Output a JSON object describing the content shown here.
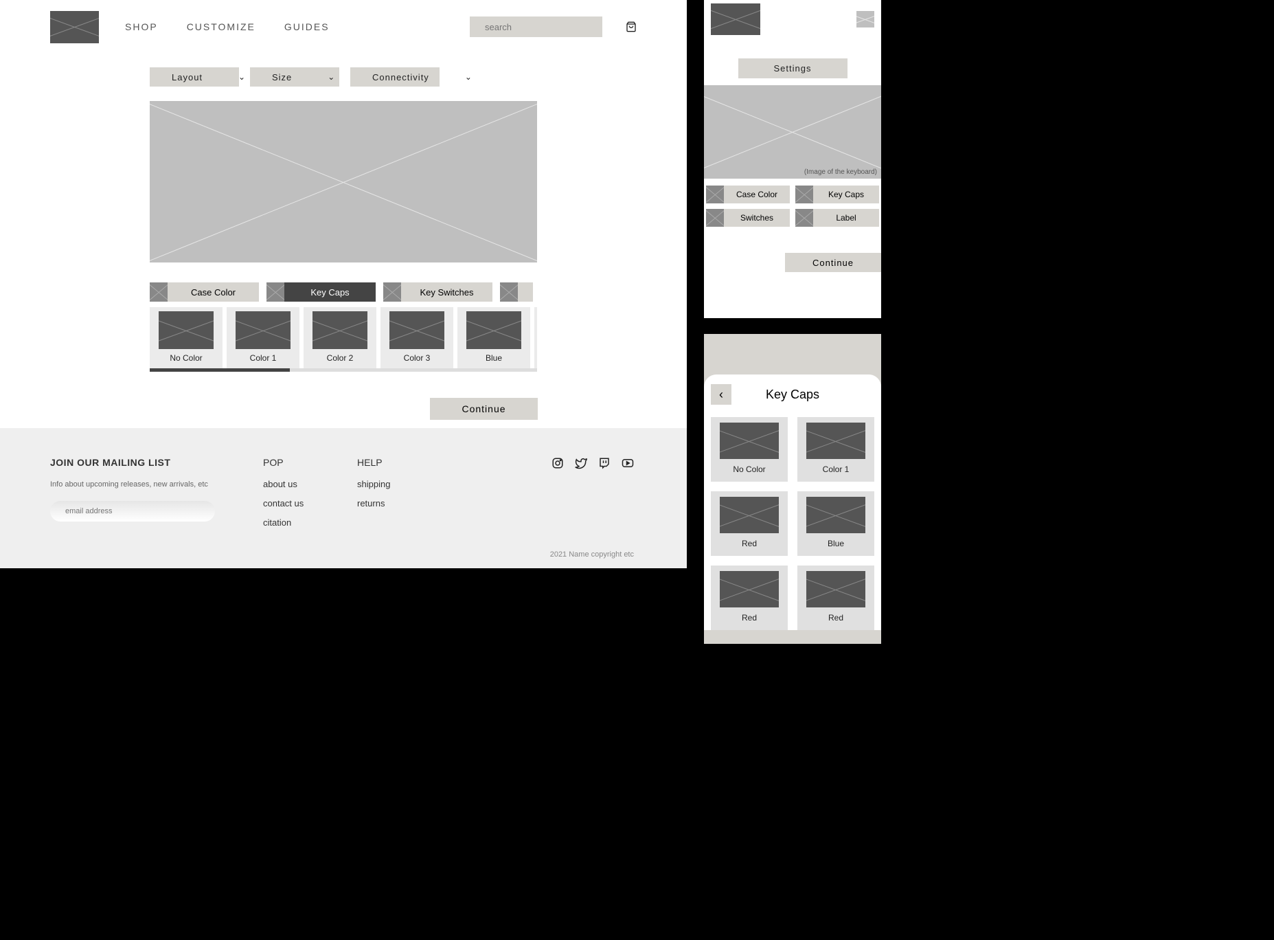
{
  "header": {
    "nav": [
      "SHOP",
      "CUSTOMIZE",
      "GUIDES"
    ],
    "search_placeholder": "search"
  },
  "filters": [
    {
      "label": "Layout"
    },
    {
      "label": "Size"
    },
    {
      "label": "Connectivity"
    }
  ],
  "tabs": {
    "case": "Case Color",
    "key": "Key Caps",
    "sw": "Key Switches"
  },
  "options": [
    {
      "label": "No Color"
    },
    {
      "label": "Color 1"
    },
    {
      "label": "Color 2"
    },
    {
      "label": "Color 3"
    },
    {
      "label": "Blue"
    }
  ],
  "continue": "Continue",
  "footer": {
    "ml_title": "JOIN OUR MAILING LIST",
    "ml_info": "Info about upcoming releases, new arrivals, etc",
    "ml_placeholder": "email address",
    "pop_title": "POP",
    "pop_links": [
      "about us",
      "contact us",
      "citation"
    ],
    "help_title": "HELP",
    "help_links": [
      "shipping",
      "returns"
    ],
    "copyright": "2021 Name copyright etc"
  },
  "m1": {
    "settings": "Settings",
    "kb_caption": "(Image of the keyboard)",
    "tiles": [
      "Case Color",
      "Key Caps",
      "Switches",
      "Label"
    ],
    "continue": "Continue"
  },
  "m2": {
    "title": "Key Caps",
    "cards": [
      "No Color",
      "Color 1",
      "Red",
      "Blue",
      "Red",
      "Red"
    ]
  }
}
